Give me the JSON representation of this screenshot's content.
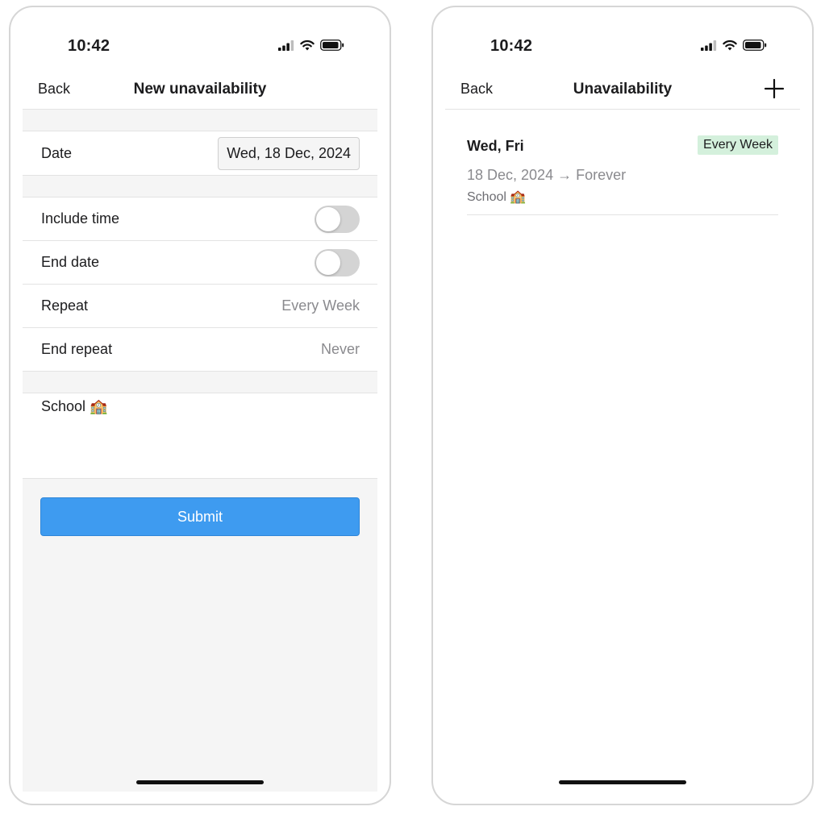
{
  "status_bar": {
    "time": "10:42"
  },
  "new_screen": {
    "nav": {
      "back_label": "Back",
      "title": "New unavailability"
    },
    "date": {
      "label": "Date",
      "value": "Wed, 18 Dec, 2024"
    },
    "include_time": {
      "label": "Include time",
      "on": false
    },
    "end_date": {
      "label": "End date",
      "on": false
    },
    "repeat": {
      "label": "Repeat",
      "value": "Every Week"
    },
    "end_repeat": {
      "label": "End repeat",
      "value": "Never"
    },
    "notes_value": "School 🏫",
    "submit_label": "Submit"
  },
  "list_screen": {
    "nav": {
      "back_label": "Back",
      "title": "Unavailability",
      "add_icon": "plus-icon"
    },
    "items": [
      {
        "days": "Wed, Fri",
        "badge": "Every Week",
        "range": "18 Dec, 2024 → Forever",
        "note": "School 🏫"
      }
    ]
  },
  "colors": {
    "accent": "#3e9bf0",
    "badge_bg": "#d4f0dc",
    "toggle_off": "#d4d4d4",
    "section_bg": "#f5f5f5"
  }
}
